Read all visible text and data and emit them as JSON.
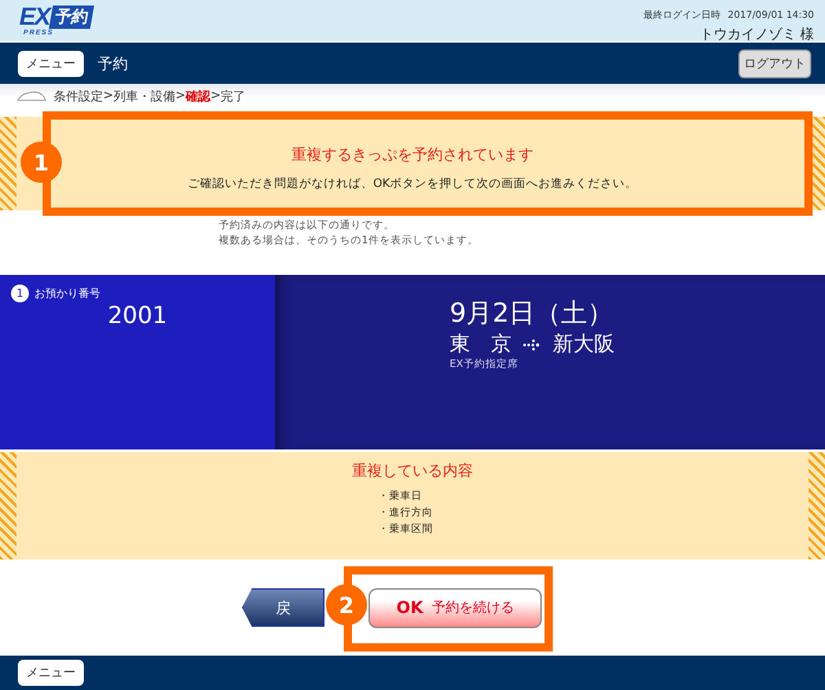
{
  "header": {
    "logo_main": "EX",
    "logo_sub": "予約",
    "logo_tag": "PRESS",
    "last_login_label": "最終ログイン日時",
    "last_login": "2017/09/01 14:30",
    "user": "トウカイノゾミ 様"
  },
  "nav": {
    "menu_button": "メニュー",
    "title": "予約",
    "logout_button": "ログアウト"
  },
  "steps": [
    {
      "label": "条件設定",
      "selected": false
    },
    {
      "label": "列車・設備",
      "selected": false
    },
    {
      "label": "確認",
      "selected": true
    },
    {
      "label": "完了",
      "selected": false
    }
  ],
  "step_separator": ">",
  "warning": {
    "title": "重複するきっぷを予約されています",
    "message": "ご確認いただき問題がなければ、OKボタンを押して次の画面へお進みください。"
  },
  "notes": [
    "予約済みの内容は以下の通りです。",
    "複数ある場合は、そのうちの1件を表示しています。"
  ],
  "reservation": {
    "index": "1",
    "number_label": "お預かり番号",
    "number": "2001",
    "date": "9月2日（土）",
    "from": "東　京",
    "to": "新大阪",
    "seat_type": "EX予約指定席"
  },
  "overlap": {
    "title": "重複している内容",
    "items": [
      "・乗車日",
      "・進行方向",
      "・乗車区間"
    ]
  },
  "buttons": {
    "back": "戻",
    "ok_mark": "OK",
    "ok_label": "予約を続ける"
  },
  "footer": {
    "menu_button": "メニュー"
  },
  "callouts": [
    {
      "number": "1"
    },
    {
      "number": "2"
    }
  ]
}
